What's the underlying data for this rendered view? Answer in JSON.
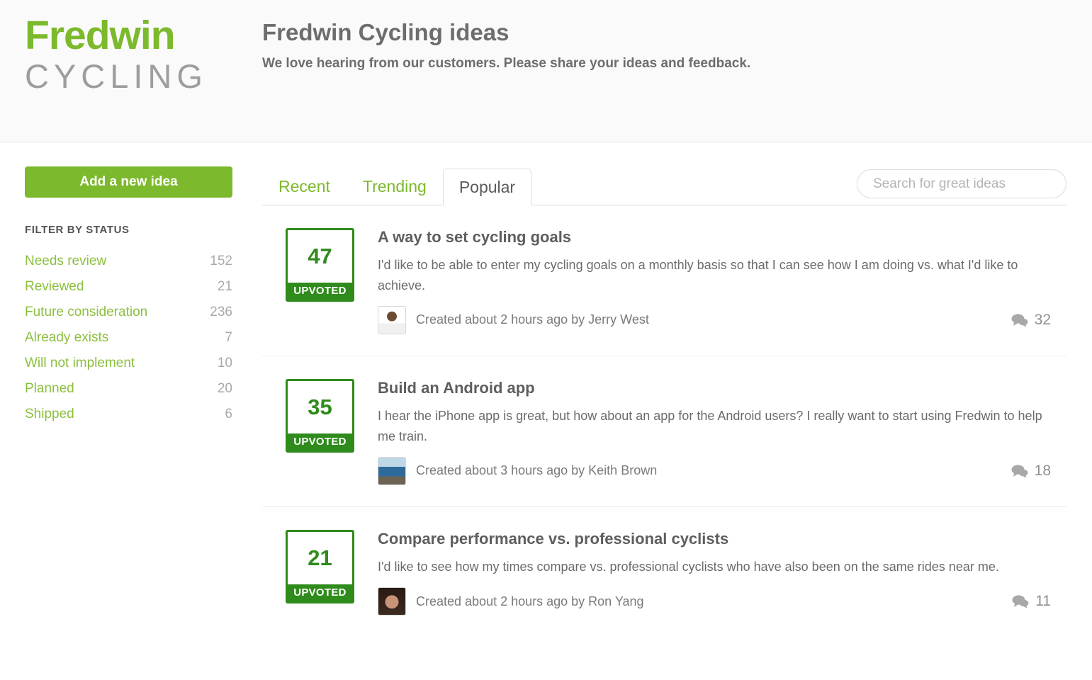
{
  "brand": {
    "name": "Fredwin",
    "subtitle": "CYCLING",
    "green": "#7cb92c"
  },
  "header": {
    "title": "Fredwin Cycling ideas",
    "subtitle": "We love hearing from our customers. Please share your ideas and feedback."
  },
  "sidebar": {
    "add_idea_label": "Add a new idea",
    "filter_heading": "FILTER BY STATUS",
    "filters": [
      {
        "label": "Needs review",
        "count": "152"
      },
      {
        "label": "Reviewed",
        "count": "21"
      },
      {
        "label": "Future consideration",
        "count": "236"
      },
      {
        "label": "Already exists",
        "count": "7"
      },
      {
        "label": "Will not implement",
        "count": "10"
      },
      {
        "label": "Planned",
        "count": "20"
      },
      {
        "label": "Shipped",
        "count": "6"
      }
    ]
  },
  "tabs": [
    {
      "label": "Recent",
      "active": false
    },
    {
      "label": "Trending",
      "active": false
    },
    {
      "label": "Popular",
      "active": true
    }
  ],
  "search": {
    "placeholder": "Search for great ideas",
    "value": "",
    "icon": "search-icon"
  },
  "ideas": [
    {
      "votes": "47",
      "vote_state": "UPVOTED",
      "title": "A way to set cycling goals",
      "description": "I'd like to be able to enter my cycling goals on a monthly basis so that I can see how I am doing vs. what I'd like to achieve.",
      "meta": "Created about 2 hours ago by Jerry West",
      "comments": "32",
      "comment_icon": "comments-icon",
      "avatar": "avatar-1"
    },
    {
      "votes": "35",
      "vote_state": "UPVOTED",
      "title": "Build an Android app",
      "description": "I hear the iPhone app is great, but how about an app for the Android users? I really want to start using Fredwin to help me train.",
      "meta": "Created about 3 hours ago by Keith Brown",
      "comments": "18",
      "comment_icon": "comments-icon",
      "avatar": "avatar-2"
    },
    {
      "votes": "21",
      "vote_state": "UPVOTED",
      "title": "Compare performance vs. professional cyclists",
      "description": "I'd like to see how my times compare vs. professional cyclists who have also been on the same rides near me.",
      "meta": "Created about 2 hours ago by Ron Yang",
      "comments": "11",
      "comment_icon": "comments-icon",
      "avatar": "avatar-3"
    }
  ]
}
